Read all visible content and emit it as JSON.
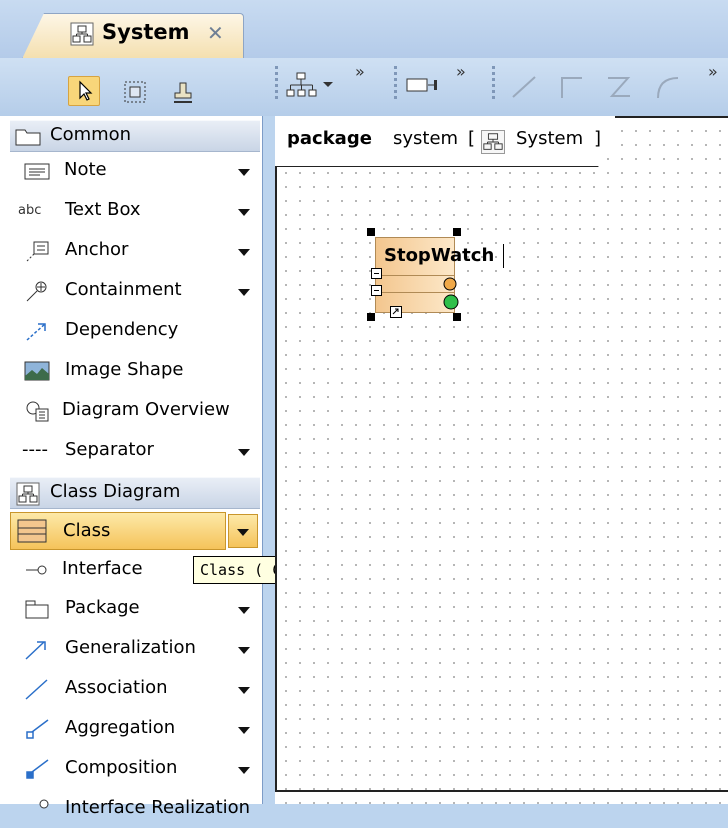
{
  "tab": {
    "title": "System",
    "close_glyph": "✕"
  },
  "diagram_toolbar": {
    "overflow_glyph": "»"
  },
  "palette": {
    "groups": [
      {
        "label": "Common",
        "icon": "folder-icon"
      },
      {
        "label": "Class Diagram",
        "icon": "class-diagram-icon"
      }
    ],
    "common_items": [
      {
        "label": "Note",
        "icon": "note-icon",
        "has_dropdown": true
      },
      {
        "label": "Text Box",
        "icon": "text-box-icon",
        "has_dropdown": true
      },
      {
        "label": "Anchor",
        "icon": "anchor-icon",
        "has_dropdown": true
      },
      {
        "label": "Containment",
        "icon": "containment-icon",
        "has_dropdown": true
      },
      {
        "label": "Dependency",
        "icon": "dependency-icon",
        "has_dropdown": false
      },
      {
        "label": "Image Shape",
        "icon": "image-shape-icon",
        "has_dropdown": false
      },
      {
        "label": "Diagram Overview",
        "icon": "diagram-overview-icon",
        "has_dropdown": false
      },
      {
        "label": "Separator",
        "icon": "separator-icon",
        "has_dropdown": true
      }
    ],
    "class_items": [
      {
        "label": "Class",
        "icon": "class-icon",
        "has_dropdown": true,
        "selected": true
      },
      {
        "label": "Interface",
        "icon": "interface-icon",
        "has_dropdown": false
      },
      {
        "label": "Package",
        "icon": "package-icon",
        "has_dropdown": true
      },
      {
        "label": "Generalization",
        "icon": "generalization-icon",
        "has_dropdown": true
      },
      {
        "label": "Association",
        "icon": "association-icon",
        "has_dropdown": true
      },
      {
        "label": "Aggregation",
        "icon": "aggregation-icon",
        "has_dropdown": true
      },
      {
        "label": "Composition",
        "icon": "composition-icon",
        "has_dropdown": true
      },
      {
        "label": "Interface Realization",
        "icon": "interface-realization-icon",
        "has_dropdown": false
      }
    ],
    "abc_glyph": "abc",
    "separator_glyph": "----"
  },
  "tooltip": {
    "text": "Class ( C )"
  },
  "diagram": {
    "frame_keyword": "package",
    "frame_name": "system",
    "bracket_open": "[",
    "bracket_close": "]",
    "diagram_ref": "System",
    "class_name": "StopWatch"
  },
  "colors": {
    "selected_item": "#f5c35a",
    "class_fill": "#f3c68e",
    "tab_active": "#f4dfae",
    "port_orange": "#f0a848",
    "port_green": "#2fbf4a"
  }
}
